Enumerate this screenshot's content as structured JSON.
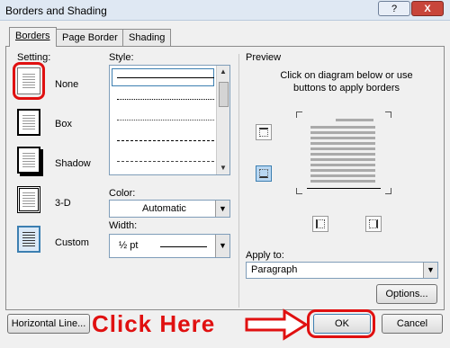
{
  "window": {
    "title": "Borders and Shading",
    "help_label": "?",
    "close_label": "X"
  },
  "tabs": [
    {
      "label": "Borders",
      "active": true
    },
    {
      "label": "Page Border",
      "active": false
    },
    {
      "label": "Shading",
      "active": false
    }
  ],
  "setting": {
    "label": "Setting:",
    "items": [
      {
        "label": "None",
        "selected": true
      },
      {
        "label": "Box",
        "selected": false
      },
      {
        "label": "Shadow",
        "selected": false
      },
      {
        "label": "3-D",
        "selected": false
      },
      {
        "label": "Custom",
        "selected": false
      }
    ]
  },
  "style": {
    "label": "Style:"
  },
  "color": {
    "label": "Color:",
    "value": "Automatic"
  },
  "width": {
    "label": "Width:",
    "value": "½ pt"
  },
  "preview": {
    "label": "Preview",
    "instructions": "Click on diagram below or use buttons to apply borders"
  },
  "apply_to": {
    "label": "Apply to:",
    "value": "Paragraph"
  },
  "buttons": {
    "options": "Options...",
    "horizontal_line": "Horizontal Line...",
    "ok": "OK",
    "cancel": "Cancel"
  },
  "annotation": {
    "text": "Click Here",
    "color": "#e01010"
  }
}
